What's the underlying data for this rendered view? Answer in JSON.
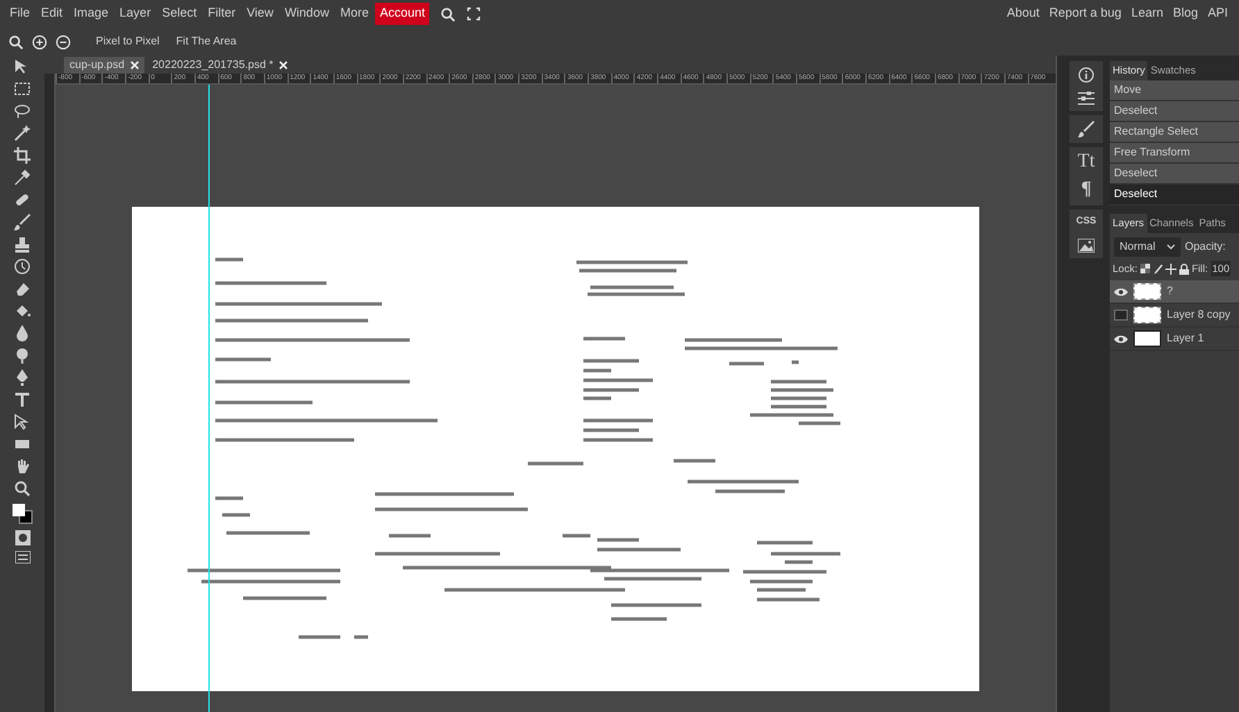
{
  "menu": {
    "items": [
      {
        "label": "File",
        "highlighted": false
      },
      {
        "label": "Edit",
        "highlighted": false
      },
      {
        "label": "Image",
        "highlighted": false
      },
      {
        "label": "Layer",
        "highlighted": false
      },
      {
        "label": "Select",
        "highlighted": false
      },
      {
        "label": "Filter",
        "highlighted": false
      },
      {
        "label": "View",
        "highlighted": false
      },
      {
        "label": "Window",
        "highlighted": false
      },
      {
        "label": "More",
        "highlighted": false
      },
      {
        "label": "Account",
        "highlighted": true
      }
    ],
    "links": [
      "About",
      "Report a bug",
      "Learn",
      "Blog",
      "API"
    ]
  },
  "toolbar": {
    "buttons": [
      "Pixel to Pixel",
      "Fit The Area"
    ]
  },
  "documents": [
    {
      "name": "cup-up.psd",
      "selected": true
    },
    {
      "name": "20220223_201735.psd *",
      "selected": false
    }
  ],
  "ruler": {
    "labels": [
      "-800",
      "-600",
      "-400",
      "-200",
      "0",
      "200",
      "400",
      "600",
      "800",
      "1000",
      "1200",
      "1400",
      "1600",
      "1800",
      "2000",
      "2200",
      "2400",
      "2600",
      "2800",
      "3000",
      "3200",
      "3400",
      "3600",
      "3800",
      "4000",
      "4200",
      "4400",
      "4600",
      "4800",
      "5000",
      "5200",
      "5400",
      "5600",
      "5800",
      "6000",
      "6200",
      "6400",
      "6600",
      "6800",
      "7000",
      "7200",
      "7400",
      "7600"
    ]
  },
  "right_toolbar": {
    "labels": [
      "Tt",
      "¶",
      "CSS"
    ]
  },
  "history": {
    "tabs": [
      {
        "label": "History",
        "selected": true
      },
      {
        "label": "Swatches",
        "selected": false
      }
    ],
    "items": [
      {
        "label": "Move",
        "selected": false
      },
      {
        "label": "Deselect",
        "selected": false
      },
      {
        "label": "Rectangle Select",
        "selected": false
      },
      {
        "label": "Free Transform",
        "selected": false
      },
      {
        "label": "Deselect",
        "selected": false
      },
      {
        "label": "Deselect",
        "selected": true
      }
    ]
  },
  "layers": {
    "tabs": [
      {
        "label": "Layers",
        "selected": true
      },
      {
        "label": "Channels",
        "selected": false
      },
      {
        "label": "Paths",
        "selected": false
      }
    ],
    "blend_mode": "Normal",
    "opacity_label": "Opacity:",
    "lock_label": "Lock:",
    "fill_label": "Fill:",
    "fill_value": "100",
    "items": [
      {
        "name": "?",
        "visible": true,
        "selected": true
      },
      {
        "name": "Layer 8 copy",
        "visible": false,
        "selected": false
      },
      {
        "name": "Layer 1",
        "visible": true,
        "selected": false
      }
    ]
  }
}
